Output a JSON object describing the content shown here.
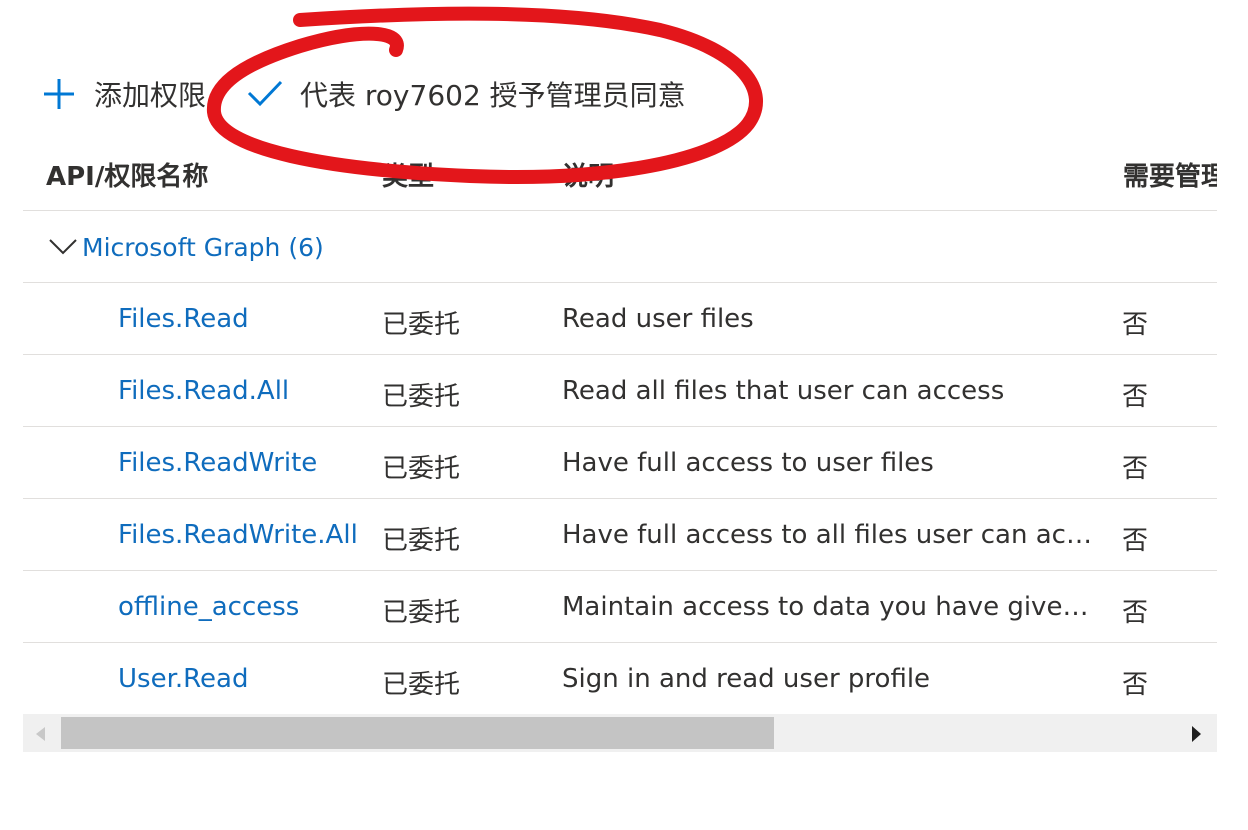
{
  "toolbar": {
    "add_label": "添加权限",
    "consent_label": "代表 roy7602 授予管理员同意",
    "add_icon": "plus-icon",
    "consent_icon": "checkmark-icon"
  },
  "table": {
    "headers": {
      "name": "API/权限名称",
      "type": "类型",
      "description": "说明",
      "admin": "需要管理"
    },
    "group": {
      "label": "Microsoft Graph (6)",
      "icon": "chevron-down-icon"
    },
    "rows": [
      {
        "name": "Files.Read",
        "type": "已委托",
        "description": "Read user files",
        "admin": "否"
      },
      {
        "name": "Files.Read.All",
        "type": "已委托",
        "description": "Read all files that user can access",
        "admin": "否"
      },
      {
        "name": "Files.ReadWrite",
        "type": "已委托",
        "description": "Have full access to user files",
        "admin": "否"
      },
      {
        "name": "Files.ReadWrite.All",
        "type": "已委托",
        "description": "Have full access to all files user can access",
        "admin": "否"
      },
      {
        "name": "offline_access",
        "type": "已委托",
        "description": "Maintain access to data you have given it access to",
        "admin": "否"
      },
      {
        "name": "User.Read",
        "type": "已委托",
        "description": "Sign in and read user profile",
        "admin": "否"
      }
    ]
  },
  "colors": {
    "link": "#0f6cbd",
    "accent": "#0078d4",
    "annotation": "#e3161b"
  }
}
